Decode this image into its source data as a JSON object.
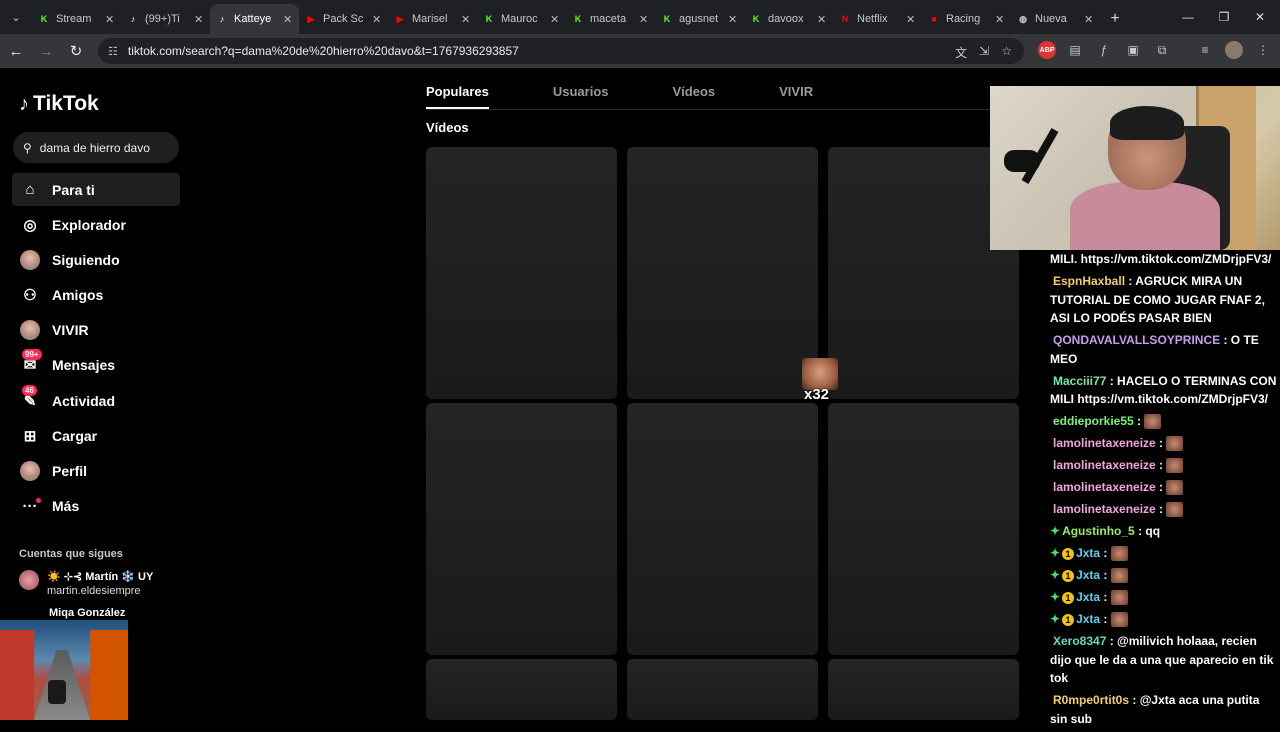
{
  "browser": {
    "tabs": [
      {
        "label": "Stream",
        "icon": "kick-icon",
        "color": "#53fc18"
      },
      {
        "label": "(99+)Ti",
        "icon": "tiktok-icon",
        "color": "#ffffff"
      },
      {
        "label": "Katteye",
        "icon": "tiktok-icon",
        "color": "#ffffff",
        "active": true
      },
      {
        "label": "Pack Sc",
        "icon": "youtube-icon",
        "color": "#ff0000"
      },
      {
        "label": "Marisel",
        "icon": "youtube-icon",
        "color": "#ff0000"
      },
      {
        "label": "Mauroc",
        "icon": "kick-icon",
        "color": "#53fc18"
      },
      {
        "label": "maceta",
        "icon": "kick-icon",
        "color": "#53fc18"
      },
      {
        "label": "agusnet",
        "icon": "kick-icon",
        "color": "#53fc18"
      },
      {
        "label": "davoox",
        "icon": "kick-icon",
        "color": "#53fc18"
      },
      {
        "label": "Netflix",
        "icon": "netflix-icon",
        "color": "#e50914"
      },
      {
        "label": "Racing",
        "icon": "racing-icon",
        "color": "#e50914"
      },
      {
        "label": "Nueva",
        "icon": "globe-icon",
        "color": "#cccccc"
      }
    ],
    "url": "tiktok.com/search?q=dama%20de%20hierro%20davo&t=1767936293857"
  },
  "sidebar": {
    "logo": "TikTok",
    "search_value": "dama de hierro davo",
    "items": [
      {
        "label": "Para ti",
        "icon": "home-icon",
        "active": true
      },
      {
        "label": "Explorador",
        "icon": "compass-icon"
      },
      {
        "label": "Siguiendo",
        "icon": "following-avatar"
      },
      {
        "label": "Amigos",
        "icon": "friends-icon"
      },
      {
        "label": "VIVIR",
        "icon": "live-avatar"
      },
      {
        "label": "Mensajes",
        "icon": "messages-icon",
        "badge": "99+"
      },
      {
        "label": "Actividad",
        "icon": "activity-icon",
        "badge": "46"
      },
      {
        "label": "Cargar",
        "icon": "upload-icon"
      },
      {
        "label": "Perfil",
        "icon": "profile-avatar"
      },
      {
        "label": "Más",
        "icon": "more-icon"
      }
    ],
    "following_title": "Cuentas que sigues",
    "following": [
      {
        "name": "☀️ ⊹⊰ Martín ❄️ UY",
        "handle": "martin.eldesiempre"
      },
      {
        "name": "Miqa González",
        "handle": ""
      }
    ]
  },
  "search_tabs": [
    "Populares",
    "Usuarios",
    "Vídeos",
    "VIVIR"
  ],
  "videos_label": "Vídeos",
  "emote_multiplier": "x32",
  "chat": [
    {
      "user": "",
      "color": "#ffffff",
      "text": "MILI. https://vm.tiktok.com/ZMDrjpFV3/"
    },
    {
      "user": "EspnHaxball",
      "color": "#f5cd6d",
      "text": "AGRUCK MIRA UN TUTORIAL DE COMO JUGAR FNAF 2, ASI LO PODÉS PASAR BIEN"
    },
    {
      "user": "QONDAVALVALLSOYPRINCE",
      "color": "#c79df0",
      "text": "O TE MEO"
    },
    {
      "user": "Macciii77",
      "color": "#7be6b0",
      "text": "HACELO O TERMINAS CON MILI https://vm.tiktok.com/ZMDrjpFV3/"
    },
    {
      "user": "eddieporkie55",
      "color": "#7cf27c",
      "text": "",
      "emote": true
    },
    {
      "user": "lamolinetaxeneize",
      "color": "#f2a6d8",
      "text": "",
      "emote": true
    },
    {
      "user": "lamolinetaxeneize",
      "color": "#f2a6d8",
      "text": "",
      "emote": true
    },
    {
      "user": "lamolinetaxeneize",
      "color": "#f2a6d8",
      "text": "",
      "emote": true
    },
    {
      "user": "lamolinetaxeneize",
      "color": "#f2a6d8",
      "text": "",
      "emote": true
    },
    {
      "user": "Agustinho_5",
      "color": "#9be86b",
      "text": "qq",
      "badge": 1
    },
    {
      "user": "Jxta",
      "color": "#5ed2f2",
      "text": "",
      "emote": true,
      "badge": 2
    },
    {
      "user": "Jxta",
      "color": "#5ed2f2",
      "text": "",
      "emote": true,
      "badge": 2
    },
    {
      "user": "Jxta",
      "color": "#5ed2f2",
      "text": "",
      "emote": true,
      "badge": 2
    },
    {
      "user": "Jxta",
      "color": "#5ed2f2",
      "text": "",
      "emote": true,
      "badge": 2
    },
    {
      "user": "Xero8347",
      "color": "#66d9c5",
      "text": "@milivich holaaa, recien dijo que le da a una que aparecio en tik tok"
    },
    {
      "user": "R0mpe0rtit0s",
      "color": "#f5cd6d",
      "text": "@Jxta aca una putita sin sub"
    }
  ]
}
